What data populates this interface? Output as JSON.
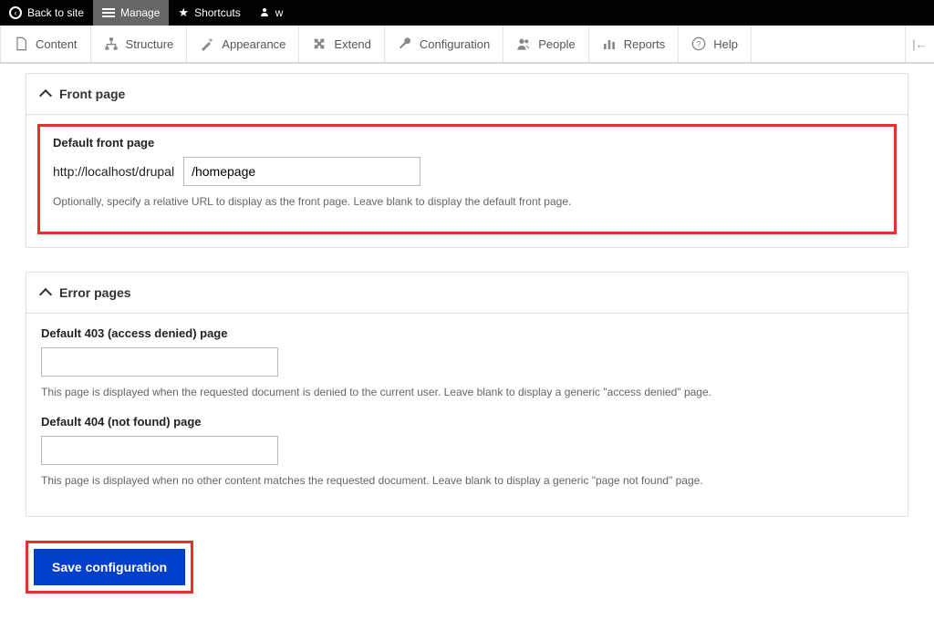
{
  "topbar": {
    "back_label": "Back to site",
    "manage_label": "Manage",
    "shortcuts_label": "Shortcuts",
    "user_label": "w"
  },
  "adminbar": {
    "items": [
      {
        "label": "Content"
      },
      {
        "label": "Structure"
      },
      {
        "label": "Appearance"
      },
      {
        "label": "Extend"
      },
      {
        "label": "Configuration"
      },
      {
        "label": "People"
      },
      {
        "label": "Reports"
      },
      {
        "label": "Help"
      }
    ]
  },
  "front_page": {
    "section_title": "Front page",
    "field_label": "Default front page",
    "prefix": "http://localhost/drupal",
    "value": "/homepage",
    "help": "Optionally, specify a relative URL to display as the front page. Leave blank to display the default front page."
  },
  "error_pages": {
    "section_title": "Error pages",
    "field_403_label": "Default 403 (access denied) page",
    "field_403_value": "",
    "field_403_help": "This page is displayed when the requested document is denied to the current user. Leave blank to display a generic \"access denied\" page.",
    "field_404_label": "Default 404 (not found) page",
    "field_404_value": "",
    "field_404_help": "This page is displayed when no other content matches the requested document. Leave blank to display a generic \"page not found\" page."
  },
  "actions": {
    "save_label": "Save configuration"
  }
}
